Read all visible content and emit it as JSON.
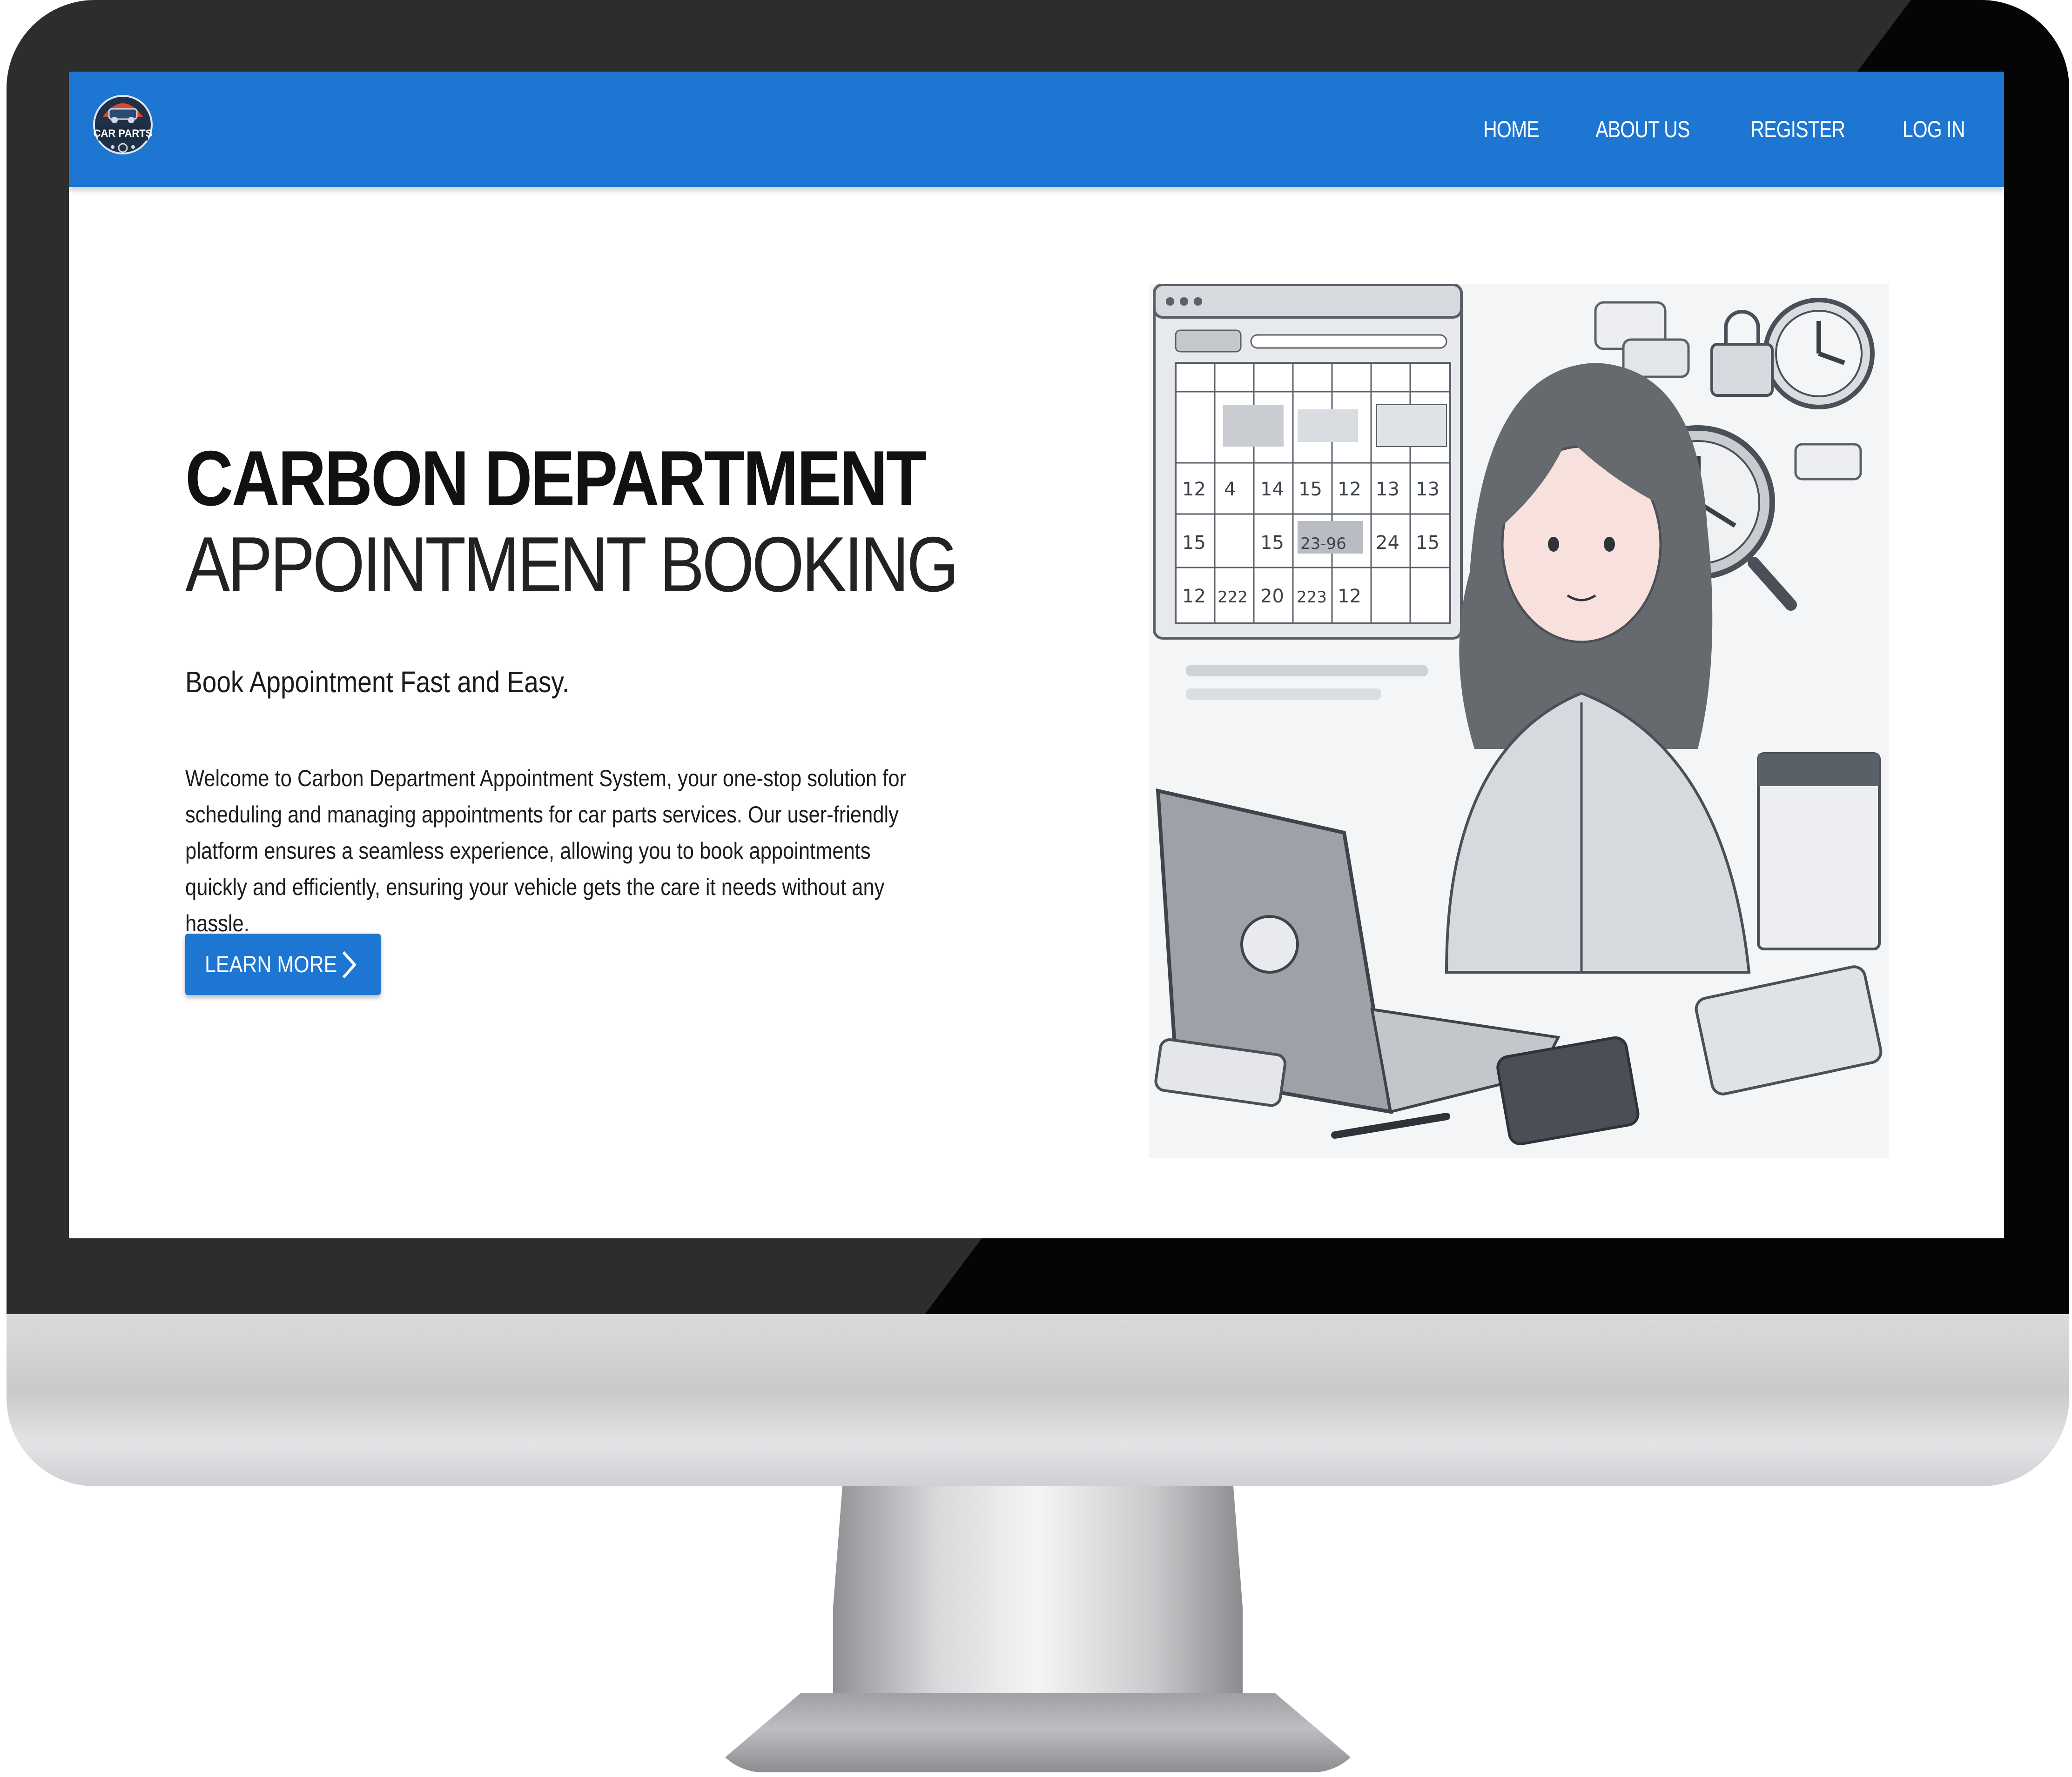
{
  "brand": {
    "logo_text": "CAR PARTS",
    "primary_color": "#1c76d2"
  },
  "nav": {
    "items": [
      {
        "label": "HOME"
      },
      {
        "label": "ABOUT US"
      },
      {
        "label": "REGISTER"
      },
      {
        "label": "LOG IN"
      }
    ]
  },
  "hero": {
    "title_line1": "CARBON DEPARTMENT",
    "title_line2": "APPOINTMENT BOOKING",
    "tagline": "Book Appointment Fast and Easy.",
    "description": "Welcome to Carbon Department Appointment System, your one-stop solution for scheduling and managing appointments for car parts services. Our user-friendly platform ensures a seamless experience, allowing you to book appointments quickly and efficiently, ensuring your vehicle gets the care it needs without any hassle.",
    "cta_label": "LEARN MORE",
    "cta_icon": "chevron-right-icon"
  },
  "illustration": {
    "calendar_cells": [
      "12",
      "4",
      "14",
      "15",
      "12",
      "13",
      "13",
      "15",
      "",
      "15",
      "23-96",
      "24",
      "15",
      "12",
      "222",
      "20",
      "223",
      "12"
    ]
  }
}
